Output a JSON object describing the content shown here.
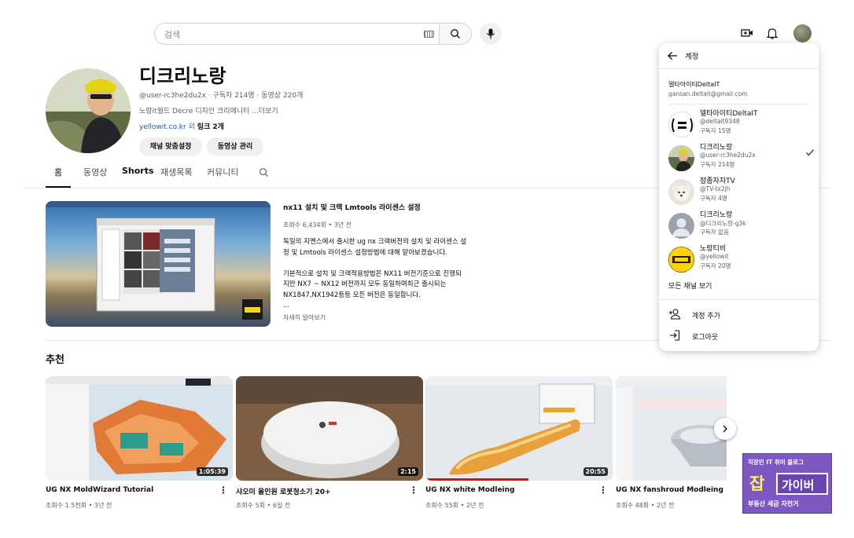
{
  "topbar": {
    "search_placeholder": "검색",
    "icons": [
      "keyboard-icon",
      "search-icon",
      "mic-icon",
      "create-video-icon",
      "bell-icon"
    ]
  },
  "channel": {
    "name": "디크리노랑",
    "meta": "@user-rc3he2du2x · 구독자 214명 · 동영상 220개",
    "description": "노랑it월드 Decre 디자인 크리에니터 ...더보기",
    "link_url": "yellowit.co.kr",
    "link_suffix": " 외 ",
    "link_count": "링크 2개",
    "buttons": {
      "customize": "채널 맞춤설정",
      "manage": "동영상 관리"
    },
    "tabs": [
      "홈",
      "동영상",
      "Shorts",
      "재생목록",
      "커뮤니티"
    ]
  },
  "featured": {
    "title": "nx11 설치 및 크랙 Lmtools 라이센스 설정",
    "meta": "조회수 6,434회 • 3년 전",
    "body": "독일의 지멘스에서 출시한 ug nx 크랙버전의 설치 및 라이센스 설\n정 및 Lmtools 라이센스 설정방법에 대해 알아보겠습니다.\n\n기본적으로 설치 및 크랙적용방법은 NX11 버전기준으로 진행되\n지만 NX7 ~ NX12 버전까지 모두 동일하며최근 출시되는\nNX1847,NX1942등등 모든 버전은 동일합니다.\n...",
    "more": "자세히 알아보기"
  },
  "recommended": {
    "heading": "추천",
    "videos": [
      {
        "title": "UG NX MoldWizard Tutorial",
        "meta": "조회수 1.5천회 • 3년 전",
        "duration": "1:05:39",
        "progress": 0
      },
      {
        "title": "샤오미 올인원 로봇청소기 20+",
        "meta": "조회수 5회 • 6일 전",
        "duration": "2:15",
        "progress": 0
      },
      {
        "title": "UG NX white Modleing",
        "meta": "조회수 55회 • 2년 전",
        "duration": "20:55",
        "progress": 0.55
      },
      {
        "title": "UG NX fanshroud Modleing",
        "meta": "조회수 48회 • 2년 전",
        "duration": "",
        "progress": 0
      }
    ]
  },
  "account_menu": {
    "header": "계정",
    "current_user": {
      "name": "델타아이티DeltaIT",
      "email": "gansan.deltait@gmail.com"
    },
    "accounts": [
      {
        "name": "델타아이티DeltaIT",
        "handle": "@deltait9348",
        "subs": "구독자 15명",
        "selected": false
      },
      {
        "name": "디크리노랑",
        "handle": "@user-rc3he2du2x",
        "subs": "구독자 214명",
        "selected": true
      },
      {
        "name": "잠좀자자TV",
        "handle": "@TV-tx2jh",
        "subs": "구독자 4명",
        "selected": false
      },
      {
        "name": "디크리노랑",
        "handle": "@디크리노랑-g3k",
        "subs": "구독자 없음",
        "selected": false
      },
      {
        "name": "노랑티비",
        "handle": "@yellowit",
        "subs": "구독자 20명",
        "selected": false
      }
    ],
    "all_channels": "모든 채널 보기",
    "add_account": "계정 추가",
    "logout": "로그아웃"
  },
  "watermark": {
    "top": "직장인 IT 취미 블로그",
    "big": "잡",
    "box": "가이버",
    "bottom": "부동산 세금 자전거"
  }
}
